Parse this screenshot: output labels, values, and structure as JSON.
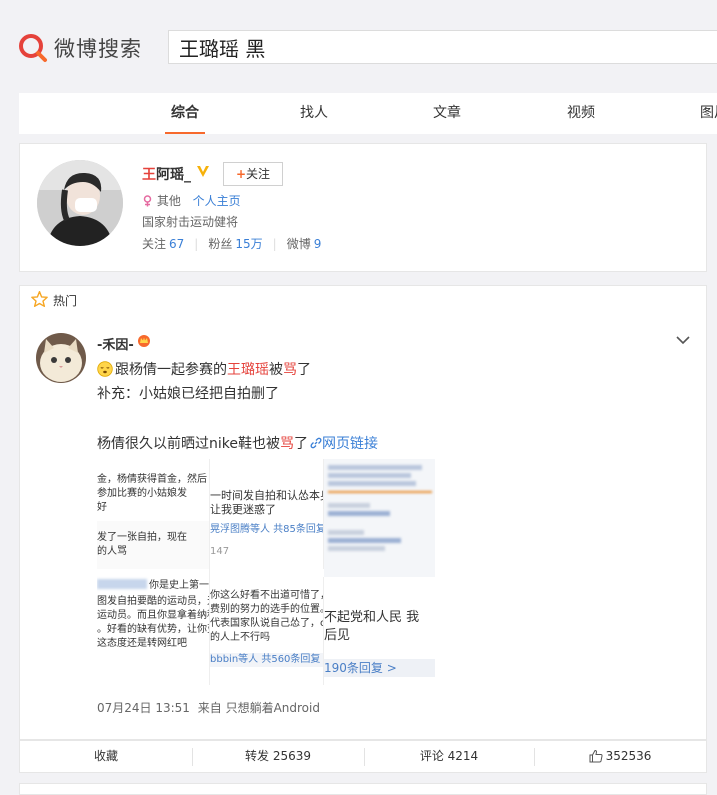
{
  "header": {
    "logo_text": "微博搜索",
    "search_value": "王璐瑶 黑"
  },
  "tabs": [
    {
      "label": "综合",
      "active": true
    },
    {
      "label": "找人"
    },
    {
      "label": "文章"
    },
    {
      "label": "视频"
    },
    {
      "label": "图片"
    }
  ],
  "user": {
    "name_highlight": "王",
    "name_rest": "阿瑶_",
    "follow_label": "关注",
    "follow_plus": "+",
    "type": "其他",
    "homepage_link": "个人主页",
    "description": "国家射击运动健将",
    "stats": [
      {
        "label": "关注",
        "value": "67"
      },
      {
        "label": "粉丝",
        "value": "15万"
      },
      {
        "label": "微博",
        "value": "9"
      }
    ]
  },
  "hot_label": "热门",
  "post": {
    "author": "-禾因-",
    "line1_pre": "跟杨倩一起参赛的",
    "line1_name": "王璐瑶",
    "line1_mid": "被",
    "line1_red": "骂",
    "line1_post": "了",
    "line2": "补充：小姑娘已经把自拍删了",
    "line3_pre": "杨倩很久以前晒过nike鞋也被",
    "line3_red": "骂",
    "line3_post": "了",
    "web_link": "网页链接",
    "time": "07月24日 13:51",
    "source": "来自 只想躺着Android",
    "collage": {
      "s1_l1": "金，杨倩获得首金，然后",
      "s1_l2": "参加比赛的小姑娘发",
      "s1_l3": "好",
      "s1b_l1": "发了一张自拍，现在",
      "s1b_l2": "的人骂",
      "s2_l1": "一时间发自拍和认怂本身",
      "s2_l2": "让我更迷惑了",
      "s2_foot": "晃浮图腾等人  共85条回复",
      "s2_num": "147",
      "s3_l1": "你是史上第一",
      "s3_l2": "图发自拍要酷的运动员，天",
      "s3_l3": "运动员。而且你显拿着纳税",
      "s3_l4": "。好看的缺有优势，让你变",
      "s3_l5": "这态度还是转网红吧",
      "s4_l1": "你这么好看不出道可惜了，",
      "s4_l2": "费别的努力的选手的位置。",
      "s4_l3": "代表国家队说自己怂了，ok",
      "s4_l4": "的人上不行吗",
      "s4_foot": "bbbin等人  共560条回复 >",
      "s5_big": "不起党和人民 我",
      "s5_big2": "后见",
      "s5_foot": "190条回复 >"
    }
  },
  "actions": {
    "favorite": "收藏",
    "repost": "转发 25639",
    "comment": "评论 4214",
    "like": "352536"
  },
  "colors": {
    "accent": "#f7692c",
    "highlight_red": "#e5423b",
    "link_blue": "#3a7fd6",
    "page_bg": "#f2f2f5"
  },
  "icons": [
    "weibo-search-logo-icon",
    "verified-v-icon",
    "female-icon",
    "star-icon",
    "crown-icon",
    "chevron-down-icon",
    "sleepy-emoji-icon",
    "link-icon",
    "thumbs-up-icon"
  ]
}
